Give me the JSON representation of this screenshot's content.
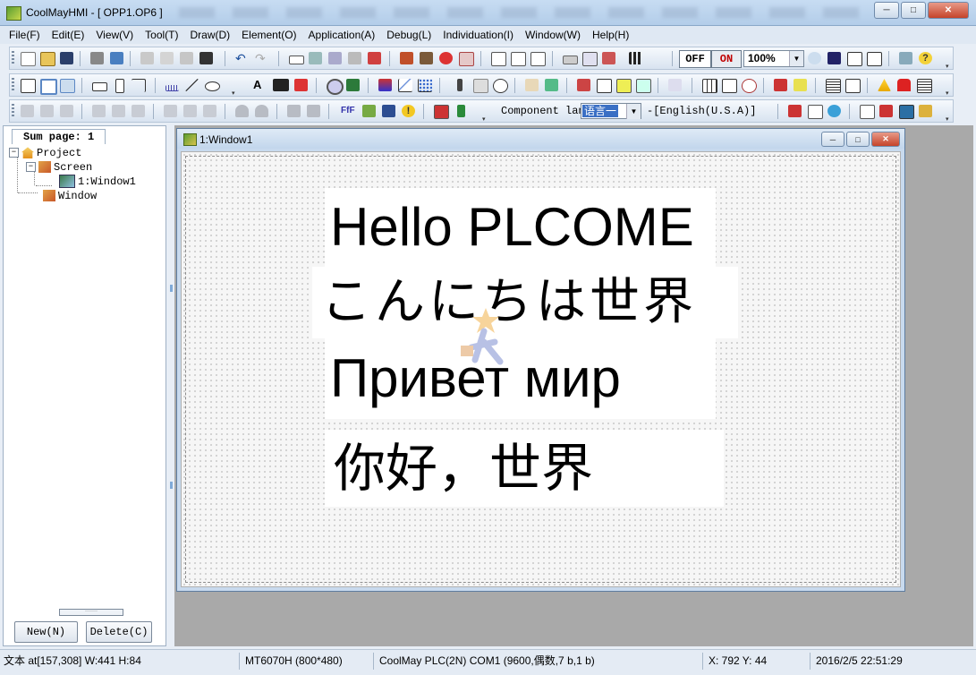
{
  "window": {
    "title": "CoolMayHMI - [ OPP1.OP6 ]",
    "controls": {
      "minimize": "─",
      "maximize": "□",
      "close": "✕"
    }
  },
  "menu": [
    "File(F)",
    "Edit(E)",
    "View(V)",
    "Tool(T)",
    "Draw(D)",
    "Element(O)",
    "Application(A)",
    "Debug(L)",
    "Individuation(I)",
    "Window(W)",
    "Help(H)"
  ],
  "toolbar": {
    "off_label": "OFF",
    "on_label": "ON",
    "zoom_value": "100%",
    "component_language_label": "Component lan",
    "language_select_value": "语言一",
    "language_option_text": "-[English(U.S.A)]"
  },
  "left_panel": {
    "sum_page": "Sum page: 1",
    "tree": {
      "project": "Project",
      "screen": "Screen",
      "window1": "1:Window1",
      "window": "Window"
    },
    "new_button": "New(N)",
    "delete_button": "Delete(C)"
  },
  "child_window": {
    "title": "1:Window1",
    "texts": {
      "english": "Hello PLCOME",
      "japanese": "こんにちは世界",
      "russian": "Привет мир",
      "chinese": "你好，世界"
    }
  },
  "status": {
    "selection": "文本 at[157,308] W:441  H:84",
    "model": "MT6070H (800*480)",
    "plc": "CoolMay PLC(2N)  COM1 (9600,偶数,7 b,1 b)",
    "coords": "X: 792  Y: 44",
    "datetime": "2016/2/5   22:51:29"
  },
  "colors": {
    "accent_blue": "#3a6fc4",
    "on_red": "#c00000",
    "mdi_background": "#a9a9a9"
  }
}
